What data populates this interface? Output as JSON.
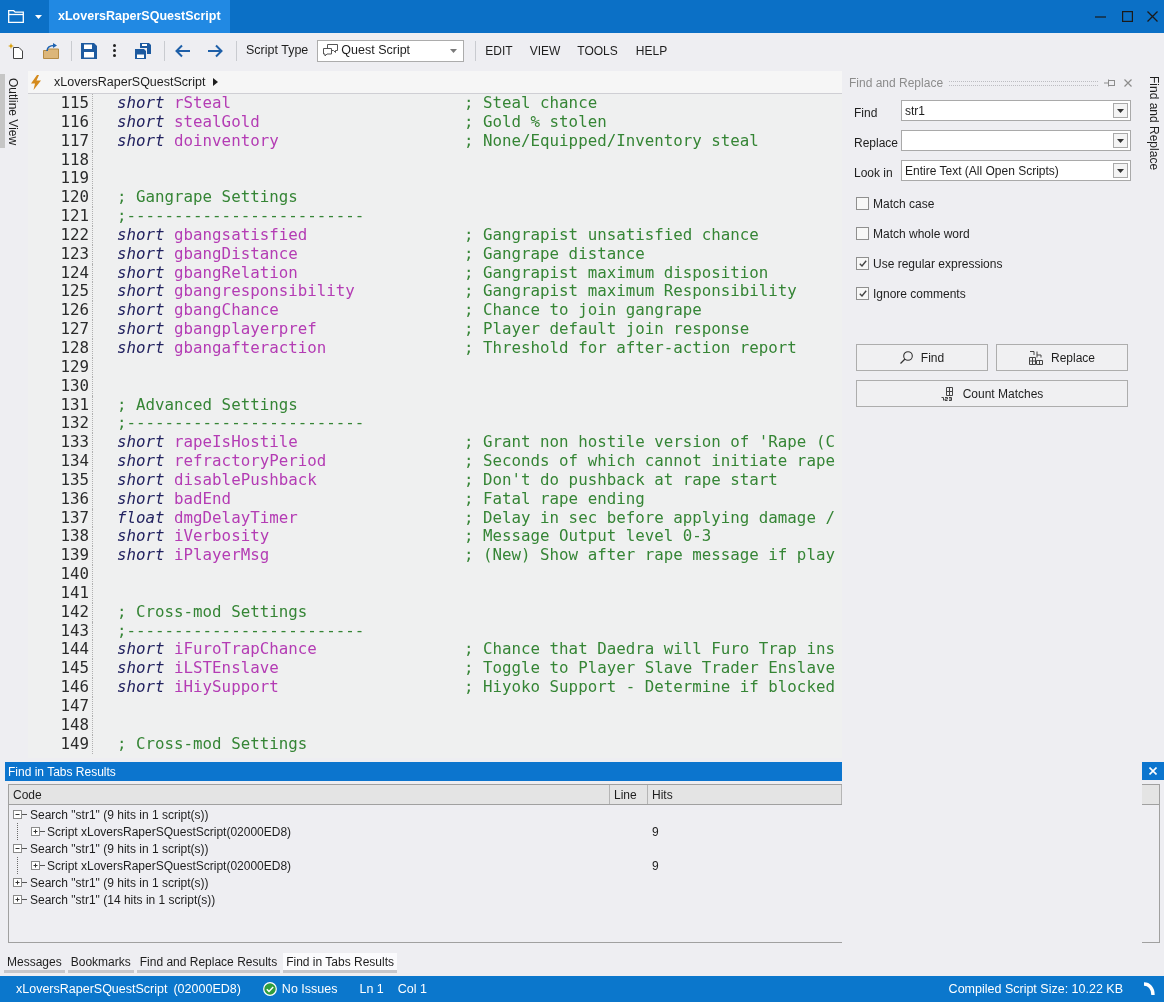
{
  "title_bar": {
    "document_tab": "xLoversRaperSQuestScript"
  },
  "toolbar": {
    "script_type_label": "Script Type",
    "script_type": "Quest Script",
    "menus": [
      "EDIT",
      "VIEW",
      "TOOLS",
      "HELP"
    ]
  },
  "outline_view": {
    "tab": "Outline View"
  },
  "breadcrumb": {
    "item": "xLoversRaperSQuestScript"
  },
  "editor": {
    "lines": [
      {
        "number": "115",
        "kind": "declaration",
        "type": "short",
        "name": "rSteal",
        "comment": "; Steal chance"
      },
      {
        "number": "116",
        "kind": "declaration",
        "type": "short",
        "name": "stealGold",
        "comment": "; Gold % stolen"
      },
      {
        "number": "117",
        "kind": "declaration",
        "type": "short",
        "name": "doinventory",
        "comment": "; None/Equipped/Inventory steal"
      },
      {
        "number": "118",
        "kind": "blank"
      },
      {
        "number": "119",
        "kind": "blank"
      },
      {
        "number": "120",
        "kind": "comment",
        "text": "; Gangrape Settings"
      },
      {
        "number": "121",
        "kind": "comment",
        "text": ";-------------------------"
      },
      {
        "number": "122",
        "kind": "declaration",
        "type": "short",
        "name": "gbangsatisfied",
        "comment": "; Gangrapist unsatisfied chance"
      },
      {
        "number": "123",
        "kind": "declaration",
        "type": "short",
        "name": "gbangDistance",
        "comment": "; Gangrape distance"
      },
      {
        "number": "124",
        "kind": "declaration",
        "type": "short",
        "name": "gbangRelation",
        "comment": "; Gangrapist maximum disposition"
      },
      {
        "number": "125",
        "kind": "declaration",
        "type": "short",
        "name": "gbangresponsibility",
        "comment": "; Gangrapist maximum Responsibility"
      },
      {
        "number": "126",
        "kind": "declaration",
        "type": "short",
        "name": "gbangChance",
        "comment": "; Chance to join gangrape"
      },
      {
        "number": "127",
        "kind": "declaration",
        "type": "short",
        "name": "gbangplayerpref",
        "comment": "; Player default join response"
      },
      {
        "number": "128",
        "kind": "declaration",
        "type": "short",
        "name": "gbangafteraction",
        "comment": "; Threshold for after-action report"
      },
      {
        "number": "129",
        "kind": "blank"
      },
      {
        "number": "130",
        "kind": "blank"
      },
      {
        "number": "131",
        "kind": "comment",
        "text": "; Advanced Settings"
      },
      {
        "number": "132",
        "kind": "comment",
        "text": ";-------------------------"
      },
      {
        "number": "133",
        "kind": "declaration",
        "type": "short",
        "name": "rapeIsHostile",
        "comment": "; Grant non hostile version of 'Rape (C"
      },
      {
        "number": "134",
        "kind": "declaration",
        "type": "short",
        "name": "refractoryPeriod",
        "comment": "; Seconds of which cannot initiate rape"
      },
      {
        "number": "135",
        "kind": "declaration",
        "type": "short",
        "name": "disablePushback",
        "comment": "; Don't do pushback at rape start"
      },
      {
        "number": "136",
        "kind": "declaration",
        "type": "short",
        "name": "badEnd",
        "comment": "; Fatal rape ending"
      },
      {
        "number": "137",
        "kind": "declaration",
        "type": "float",
        "name": "dmgDelayTimer",
        "comment": "; Delay in sec before applying damage /"
      },
      {
        "number": "138",
        "kind": "declaration",
        "type": "short",
        "name": "iVerbosity",
        "comment": "; Message Output level 0-3"
      },
      {
        "number": "139",
        "kind": "declaration",
        "type": "short",
        "name": "iPlayerMsg",
        "comment": "; (New) Show after rape message if play"
      },
      {
        "number": "140",
        "kind": "blank"
      },
      {
        "number": "141",
        "kind": "blank"
      },
      {
        "number": "142",
        "kind": "comment",
        "text": "; Cross-mod Settings"
      },
      {
        "number": "143",
        "kind": "comment",
        "text": ";-------------------------"
      },
      {
        "number": "144",
        "kind": "declaration",
        "type": "short",
        "name": "iFuroTrapChance",
        "comment": "; Chance that Daedra will Furo Trap ins"
      },
      {
        "number": "145",
        "kind": "declaration",
        "type": "short",
        "name": "iLSTEnslave",
        "comment": "; Toggle to Player Slave Trader Enslave"
      },
      {
        "number": "146",
        "kind": "declaration",
        "type": "short",
        "name": "iHiySupport",
        "comment": "; Hiyoko Support - Determine if blocked"
      },
      {
        "number": "147",
        "kind": "blank"
      },
      {
        "number": "148",
        "kind": "blank"
      },
      {
        "number": "149",
        "kind": "comment",
        "text": "; Cross-mod Settings"
      }
    ]
  },
  "find_panel": {
    "title": "Find and Replace",
    "fields": [
      {
        "label": "Find",
        "value": "str1"
      },
      {
        "label": "Replace"
      },
      {
        "label": "Look in",
        "value": "Entire Text (All Open Scripts)"
      }
    ],
    "options": [
      {
        "label": "Match case",
        "checked": false
      },
      {
        "label": "Match whole word",
        "checked": false
      },
      {
        "label": "Use regular expressions",
        "checked": true
      },
      {
        "label": "Ignore comments",
        "checked": true
      }
    ],
    "buttons": [
      {
        "label": "Find",
        "kind": "find"
      },
      {
        "label": "Replace",
        "kind": "replace"
      },
      {
        "label": "Count Matches",
        "kind": "count"
      }
    ]
  },
  "right_dock": {
    "tab": "Find and Replace"
  },
  "results": {
    "title": "Find in Tabs Results",
    "columns": [
      "Code",
      "Line",
      "Hits"
    ],
    "rows": [
      {
        "text": "Search \"str1\" (9 hits in 1 script(s))",
        "expanded": true,
        "children": [
          {
            "text": "Script xLoversRaperSQuestScript(02000ED8)",
            "expanded": false,
            "hits": "9"
          }
        ]
      },
      {
        "text": "Search \"str1\" (9 hits in 1 script(s))",
        "expanded": true,
        "children": [
          {
            "text": "Script xLoversRaperSQuestScript(02000ED8)",
            "expanded": false,
            "hits": "9"
          }
        ]
      },
      {
        "text": "Search \"str1\" (9 hits in 1 script(s))",
        "expanded": false
      },
      {
        "text": "Search \"str1\" (14 hits in 1 script(s))",
        "expanded": false
      }
    ]
  },
  "bottom_tabs": [
    {
      "label": "Messages",
      "selected": false
    },
    {
      "label": "Bookmarks",
      "selected": false
    },
    {
      "label": "Find and Replace Results",
      "selected": false
    },
    {
      "label": "Find in Tabs Results",
      "selected": true
    }
  ],
  "status_bar": {
    "script": "xLoversRaperSQuestScript",
    "form_id": "(02000ED8)",
    "issues": "No Issues",
    "line": "Ln 1",
    "column": "Col 1",
    "compiled_size": "Compiled Script Size: 10.22 KB"
  }
}
